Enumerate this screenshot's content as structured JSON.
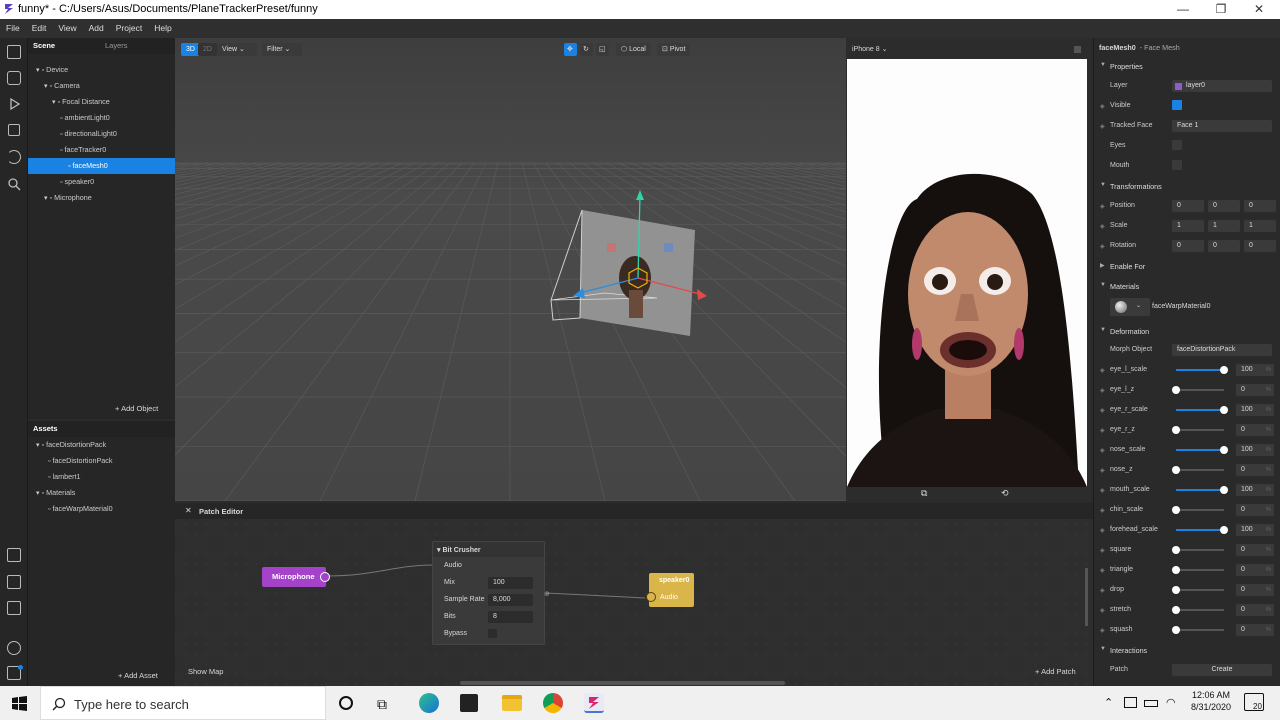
{
  "window": {
    "title": "funny* - C:/Users/Asus/Documents/PlaneTrackerPreset/funny"
  },
  "menu": [
    "File",
    "Edit",
    "View",
    "Add",
    "Project",
    "Help"
  ],
  "scene_panel": {
    "tabs": [
      "Scene",
      "Layers"
    ],
    "tree": [
      {
        "label": "Device",
        "indent": 0,
        "icon": "device-icon"
      },
      {
        "label": "Camera",
        "indent": 1,
        "icon": "camera-icon"
      },
      {
        "label": "Focal Distance",
        "indent": 2,
        "icon": "focal-icon"
      },
      {
        "label": "ambientLight0",
        "indent": 3,
        "icon": "ambient-light-icon"
      },
      {
        "label": "directionalLight0",
        "indent": 3,
        "icon": "directional-light-icon"
      },
      {
        "label": "faceTracker0",
        "indent": 3,
        "icon": "face-tracker-icon"
      },
      {
        "label": "faceMesh0",
        "indent": 4,
        "icon": "face-mesh-icon",
        "selected": true
      },
      {
        "label": "speaker0",
        "indent": 3,
        "icon": "speaker-icon"
      },
      {
        "label": "Microphone",
        "indent": 1,
        "icon": "microphone-icon"
      }
    ],
    "add_object": "Add Object"
  },
  "assets_panel": {
    "title": "Assets",
    "tree": [
      {
        "label": "faceDistortionPack",
        "indent": 0,
        "icon": "file-icon"
      },
      {
        "label": "faceDistortionPack",
        "indent": 1,
        "icon": "mesh-icon"
      },
      {
        "label": "lambert1",
        "indent": 1,
        "icon": "material-icon"
      },
      {
        "label": "Materials",
        "indent": 0,
        "icon": "folder-icon"
      },
      {
        "label": "faceWarpMaterial0",
        "indent": 1,
        "icon": "material-icon"
      }
    ],
    "add_asset": "Add Asset"
  },
  "viewport": {
    "mode3d": "3D",
    "mode2d": "2D",
    "view": "View",
    "filter": "Filter",
    "local": "Local",
    "pivot": "Pivot"
  },
  "preview": {
    "device": "iPhone 8"
  },
  "properties": {
    "object": "faceMesh0",
    "type": "- Face Mesh",
    "sections": {
      "properties": "Properties",
      "transformations": "Transformations",
      "enable_for": "Enable For",
      "materials": "Materials",
      "deformation": "Deformation",
      "interactions": "Interactions"
    },
    "layer_label": "Layer",
    "layer_value": "layer0",
    "visible_label": "Visible",
    "tracked_face_label": "Tracked Face",
    "tracked_face_value": "Face 1",
    "eyes_label": "Eyes",
    "mouth_label": "Mouth",
    "position_label": "Position",
    "position": [
      "0",
      "0",
      "0"
    ],
    "scale_label": "Scale",
    "scale": [
      "1",
      "1",
      "1"
    ],
    "rotation_label": "Rotation",
    "rotation": [
      "0",
      "0",
      "0"
    ],
    "material_name": "faceWarpMaterial0",
    "morph_label": "Morph Object",
    "morph_value": "faceDistortionPack",
    "sliders": [
      {
        "label": "eye_l_scale",
        "value": "100",
        "level": 1
      },
      {
        "label": "eye_l_z",
        "value": "0",
        "level": 0
      },
      {
        "label": "eye_r_scale",
        "value": "100",
        "level": 1
      },
      {
        "label": "eye_r_z",
        "value": "0",
        "level": 0
      },
      {
        "label": "nose_scale",
        "value": "100",
        "level": 1
      },
      {
        "label": "nose_z",
        "value": "0",
        "level": 0
      },
      {
        "label": "mouth_scale",
        "value": "100",
        "level": 1
      },
      {
        "label": "chin_scale",
        "value": "0",
        "level": 0
      },
      {
        "label": "forehead_scale",
        "value": "100",
        "level": 1
      },
      {
        "label": "square",
        "value": "0",
        "level": 0
      },
      {
        "label": "triangle",
        "value": "0",
        "level": 0
      },
      {
        "label": "drop",
        "value": "0",
        "level": 0
      },
      {
        "label": "stretch",
        "value": "0",
        "level": 0
      },
      {
        "label": "squash",
        "value": "0",
        "level": 0
      }
    ],
    "percent": "%",
    "patch_label": "Patch",
    "create_label": "Create"
  },
  "patch_editor": {
    "title": "Patch Editor",
    "microphone": "Microphone",
    "bitcrusher": {
      "title": "Bit Crusher",
      "audio": "Audio",
      "mix_label": "Mix",
      "mix": "100",
      "rate_label": "Sample Rate",
      "rate": "8,000",
      "bits_label": "Bits",
      "bits": "8",
      "bypass_label": "Bypass"
    },
    "speaker": {
      "title": "speaker0",
      "audio": "Audio"
    },
    "show_map": "Show Map",
    "add_patch": "Add Patch"
  },
  "taskbar": {
    "search": "Type here to search",
    "time": "12:06 AM",
    "date": "8/31/2020",
    "notifications": "20"
  },
  "colors": {
    "accent": "#1a82e2",
    "mic_node": "#a443c9",
    "speaker_node": "#d9b54a"
  }
}
